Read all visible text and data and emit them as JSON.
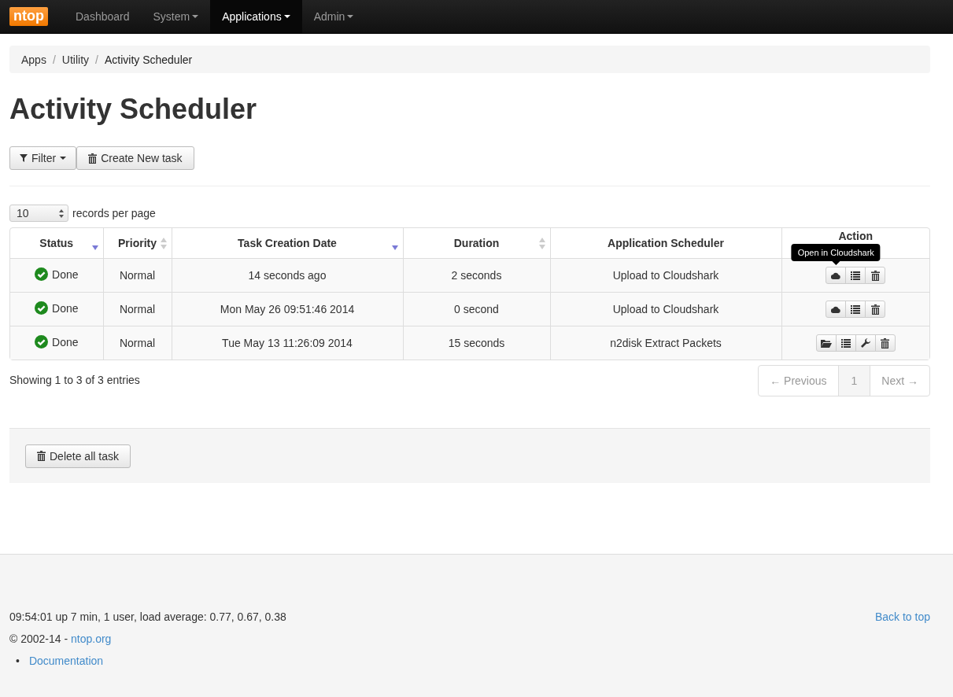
{
  "navbar": {
    "brand": "ntop",
    "items": [
      {
        "label": "Dashboard",
        "dropdown": false,
        "selected": false
      },
      {
        "label": "System",
        "dropdown": true,
        "selected": false
      },
      {
        "label": "Applications",
        "dropdown": true,
        "selected": true
      },
      {
        "label": "Admin",
        "dropdown": true,
        "selected": false
      }
    ]
  },
  "breadcrumb": [
    {
      "label": "Apps",
      "current": false
    },
    {
      "separator": "/",
      "label": "Utility",
      "current": false
    },
    {
      "separator": "/",
      "label": "Activity Scheduler",
      "current": true
    }
  ],
  "title": "Activity Scheduler",
  "toolbar": [
    {
      "kind": "filter",
      "label": "Filter"
    },
    {
      "kind": "create",
      "label": "Create New task"
    }
  ],
  "page_size": {
    "value": "10",
    "label": "records per page"
  },
  "table": {
    "columns": [
      {
        "label": "Status",
        "sortable": true,
        "sorted": true
      },
      {
        "label": "Priority",
        "sortable": true,
        "sorted": false
      },
      {
        "label": "Task Creation Date",
        "sortable": true,
        "sorted": true
      },
      {
        "label": "Duration",
        "sortable": true,
        "sorted": false
      },
      {
        "label": "Application Scheduler",
        "sortable": false
      },
      {
        "label": "Action",
        "sortable": false
      }
    ],
    "rows": [
      {
        "status": "Done",
        "priority": "Normal",
        "created": "14 seconds ago",
        "duration": "2 seconds",
        "application": "Upload to Cloudshark",
        "actions": [
          {
            "kind": "cloud",
            "tooltip": "Open in Cloudshark"
          },
          {
            "kind": "list"
          },
          {
            "kind": "trash"
          }
        ]
      },
      {
        "status": "Done",
        "priority": "Normal",
        "created": "Mon May 26 09:51:46 2014",
        "duration": "0 second",
        "application": "Upload to Cloudshark",
        "actions": [
          {
            "kind": "cloud"
          },
          {
            "kind": "list"
          },
          {
            "kind": "trash"
          }
        ]
      },
      {
        "status": "Done",
        "priority": "Normal",
        "created": "Tue May 13 11:26:09 2014",
        "duration": "15 seconds",
        "application": "n2disk Extract Packets",
        "actions": [
          {
            "kind": "folder"
          },
          {
            "kind": "list"
          },
          {
            "kind": "wrench"
          },
          {
            "kind": "trash"
          }
        ]
      }
    ]
  },
  "info": "Showing 1 to 3 of 3 entries",
  "pagination": [
    {
      "label": "← Previous",
      "kind": "prev",
      "disabled": true
    },
    {
      "label": "1",
      "kind": "page",
      "disabled": true
    },
    {
      "label": "Next →",
      "kind": "next",
      "disabled": true
    }
  ],
  "delete_all": "Delete all task",
  "footer": {
    "uptime": "09:54:01 up 7 min, 1 user, load average: 0.77, 0.67, 0.38",
    "back_to_top": "Back to top",
    "copyright": "© 2002-14 - ",
    "copyright_link": "ntop.org",
    "links": [
      {
        "bullet": "•",
        "label": "Documentation"
      }
    ]
  }
}
